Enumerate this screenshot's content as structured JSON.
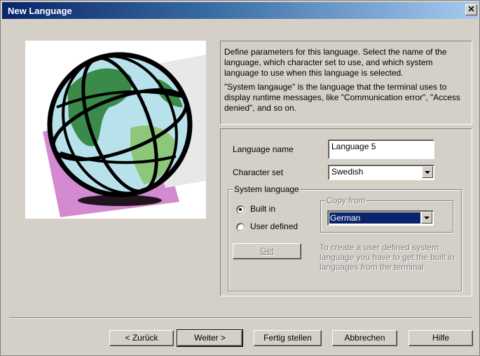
{
  "window": {
    "title": "New Language",
    "close_glyph": "✕"
  },
  "info": {
    "paragraph1": "Define parameters for this language. Select the name of the language, which character set to use, and which system language to use when this language is selected.",
    "paragraph2": "\"System langauge\" is the language that the terminal uses to display runtime messages, like \"Communication error\", \"Access denied\", and so on."
  },
  "form": {
    "language_name_label": "Language name",
    "language_name_value": "Language 5",
    "character_set_label": "Character set",
    "character_set_value": "Swedish",
    "system_language_legend": "System language",
    "radio_built_in": "Built in",
    "radio_user_defined": "User defined",
    "radio_selected": "built-in",
    "copy_from_legend": "Copy from",
    "copy_from_value": "German",
    "get_button": "Get",
    "hint": "To create a user defined system language you have to get the built in languages from the terminal."
  },
  "buttons": {
    "back": "< Zurück",
    "next": "Weiter >",
    "finish": "Fertig stellen",
    "cancel": "Abbrechen",
    "help": "Hilfe"
  },
  "colors": {
    "title_bar": "#0a246a",
    "face": "#d4d0c8",
    "selection": "#0a246a",
    "globe_ocean": "#9fd3e0",
    "globe_land": "#3a8a4a",
    "pink_backdrop": "#d38ad0"
  },
  "icons": [
    "globe-illustration",
    "close-icon",
    "dropdown-arrow-icon",
    "radio-icon"
  ]
}
